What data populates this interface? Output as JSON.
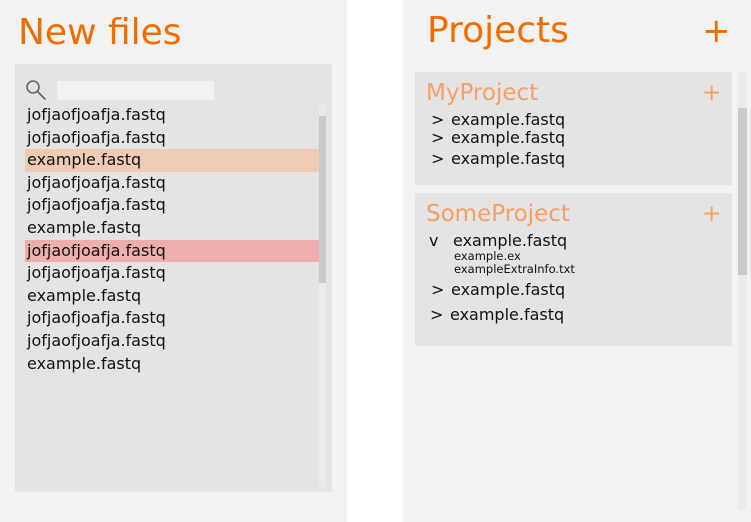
{
  "colors": {
    "accent": "#f26d00",
    "accent_light": "#f5a066",
    "selected_orange": "#eecbb3",
    "selected_red": "#eeaeae"
  },
  "left": {
    "title": "New files",
    "search": {
      "icon": "search-icon",
      "placeholder": "",
      "value": ""
    },
    "files": [
      {
        "name": "jofjaofjoafja.fastq",
        "state": "normal"
      },
      {
        "name": "jofjaofjoafja.fastq",
        "state": "normal"
      },
      {
        "name": "example.fastq",
        "state": "selected-orange"
      },
      {
        "name": "jofjaofjoafja.fastq",
        "state": "normal"
      },
      {
        "name": "jofjaofjoafja.fastq",
        "state": "normal"
      },
      {
        "name": "example.fastq",
        "state": "normal"
      },
      {
        "name": "jofjaofjoafja.fastq",
        "state": "selected-red"
      },
      {
        "name": "jofjaofjoafja.fastq",
        "state": "normal"
      },
      {
        "name": "example.fastq",
        "state": "normal"
      },
      {
        "name": "jofjaofjoafja.fastq",
        "state": "normal"
      },
      {
        "name": "jofjaofjoafja.fastq",
        "state": "normal"
      },
      {
        "name": "example.fastq",
        "state": "normal"
      }
    ]
  },
  "right": {
    "title": "Projects",
    "add_label": "+",
    "projects": [
      {
        "name": "MyProject",
        "add_label": "+",
        "files": [
          {
            "toggle": ">",
            "name": "example.fastq"
          },
          {
            "toggle": ">",
            "name": "example.fastq"
          },
          {
            "toggle": ">",
            "name": "example.fastq"
          }
        ]
      },
      {
        "name": "SomeProject",
        "add_label": "+",
        "files": [
          {
            "toggle": "v",
            "name": "example.fastq",
            "children": [
              "example.ex",
              "exampleExtraInfo.txt"
            ]
          },
          {
            "toggle": ">",
            "name": "example.fastq"
          },
          {
            "toggle": ">",
            "name": "example.fastq"
          }
        ]
      }
    ]
  }
}
